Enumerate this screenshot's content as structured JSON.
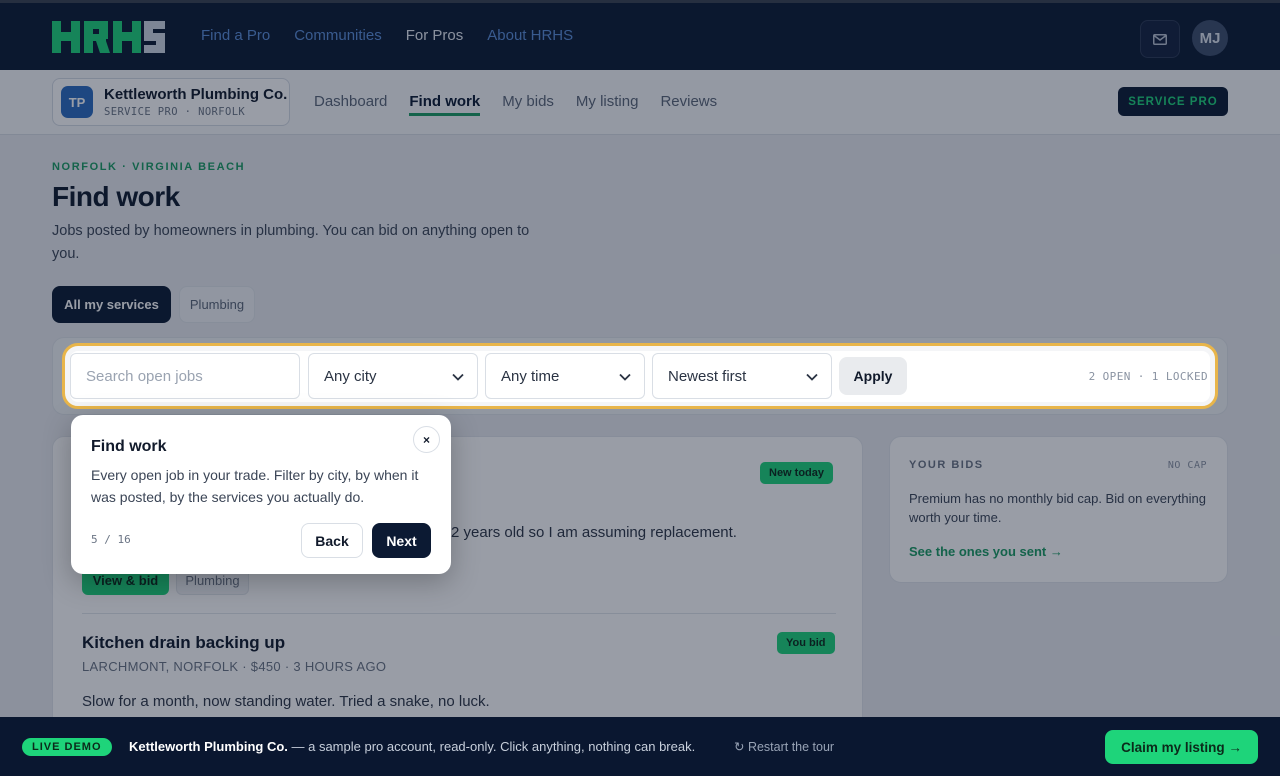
{
  "topbar": {
    "logo_text": "HRHS",
    "nav": [
      "Find a Pro",
      "Communities",
      "For Pros",
      "About HRHS"
    ],
    "active_nav": "For Pros",
    "mail_icon": "mail-icon",
    "avatar_initials": "MJ"
  },
  "subbar": {
    "business_initials": "TP",
    "business_name": "Kettleworth Plumbing Co.",
    "business_sub": "SERVICE PRO · NORFOLK",
    "tabs": [
      "Dashboard",
      "Find work",
      "My bids",
      "My listing",
      "Reviews"
    ],
    "active_tab": "Find work",
    "role_badge": "SERVICE PRO"
  },
  "page": {
    "eyebrow": "NORFOLK · VIRGINIA BEACH",
    "title": "Find work",
    "description": "Jobs posted by homeowners in plumbing. You can bid on anything open to you.",
    "service_tabs": [
      "All my services",
      "Plumbing"
    ]
  },
  "filters": {
    "search_placeholder": "Search open jobs",
    "city": "Any city",
    "time": "Any time",
    "sort": "Newest first",
    "apply_label": "Apply",
    "open_count": "2 OPEN · 1 LOCKED"
  },
  "jobs": [
    {
      "badge": "New today",
      "desc_partial": "2 years old so I am assuming replacement.",
      "action": "View & bid",
      "tag": "Plumbing"
    },
    {
      "title": "Kitchen drain backing up",
      "badge": "You bid",
      "meta": "LARCHMONT, NORFOLK · $450 · 3 HOURS AGO",
      "desc": "Slow for a month, now standing water. Tried a snake, no luck."
    }
  ],
  "bids_card": {
    "heading": "YOUR BIDS",
    "note": "NO CAP",
    "description": "Premium has no monthly bid cap. Bid on everything worth your time.",
    "link": "See the ones you sent →"
  },
  "tour": {
    "title": "Find work",
    "body": "Every open job in your trade. Filter by city, by when it was posted, by the services you actually do.",
    "step": "5 / 16",
    "back_label": "Back",
    "next_label": "Next",
    "close_label": "×"
  },
  "demo_banner": {
    "pill": "LIVE DEMO",
    "business": "Kettleworth Plumbing Co.",
    "message": " — a sample pro account, read-only. Click anything, nothing can break.",
    "restart": "↻ Restart the tour",
    "claim": "Claim my listing →"
  },
  "colors": {
    "navy": "#0c1a33",
    "accent_green": "#1ed47a",
    "link_blue": "#5b8ed8",
    "spotlight": "#e8b54a"
  }
}
